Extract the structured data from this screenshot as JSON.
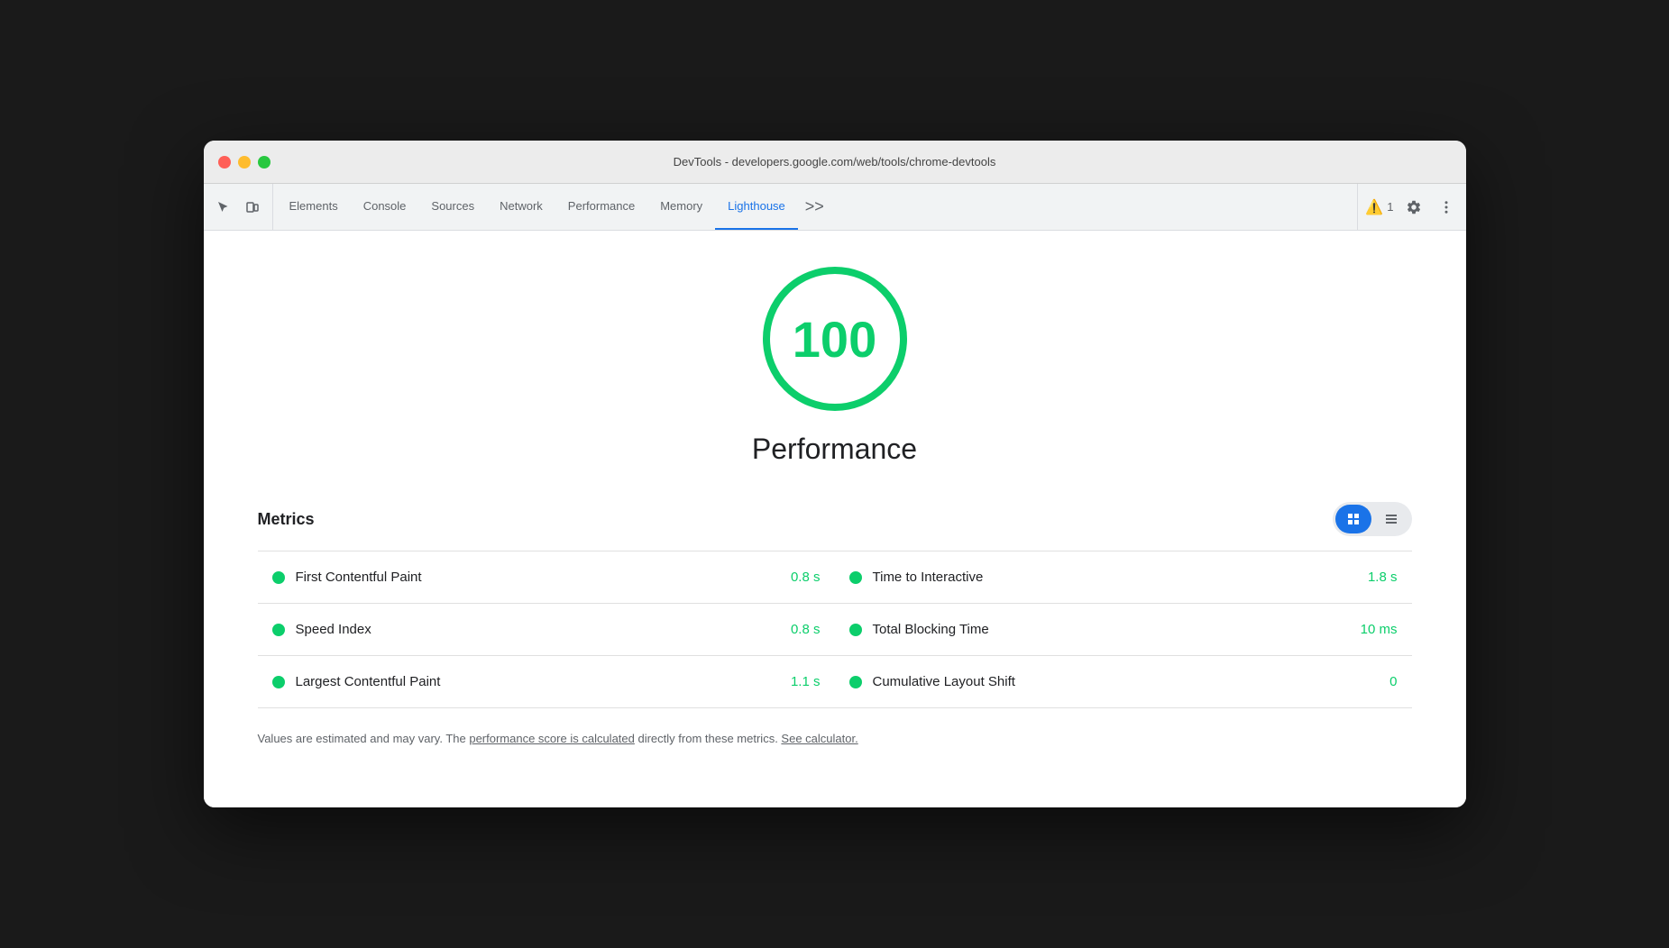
{
  "window": {
    "title": "DevTools - developers.google.com/web/tools/chrome-devtools"
  },
  "toolbar": {
    "tabs": [
      {
        "id": "elements",
        "label": "Elements",
        "active": false
      },
      {
        "id": "console",
        "label": "Console",
        "active": false
      },
      {
        "id": "sources",
        "label": "Sources",
        "active": false
      },
      {
        "id": "network",
        "label": "Network",
        "active": false
      },
      {
        "id": "performance",
        "label": "Performance",
        "active": false
      },
      {
        "id": "memory",
        "label": "Memory",
        "active": false
      },
      {
        "id": "lighthouse",
        "label": "Lighthouse",
        "active": true
      }
    ],
    "warning_count": "1",
    "more_tabs": ">>"
  },
  "score": {
    "value": "100",
    "label": "Performance"
  },
  "metrics": {
    "title": "Metrics",
    "rows": [
      {
        "left_name": "First Contentful Paint",
        "left_value": "0.8 s",
        "right_name": "Time to Interactive",
        "right_value": "1.8 s"
      },
      {
        "left_name": "Speed Index",
        "left_value": "0.8 s",
        "right_name": "Total Blocking Time",
        "right_value": "10 ms"
      },
      {
        "left_name": "Largest Contentful Paint",
        "left_value": "1.1 s",
        "right_name": "Cumulative Layout Shift",
        "right_value": "0"
      }
    ]
  },
  "footer": {
    "text_before": "Values are estimated and may vary. The ",
    "link1": "performance score is calculated",
    "text_middle": " directly from these metrics. ",
    "link2": "See calculator."
  },
  "colors": {
    "green": "#0cce6b",
    "blue_active": "#1a73e8"
  }
}
